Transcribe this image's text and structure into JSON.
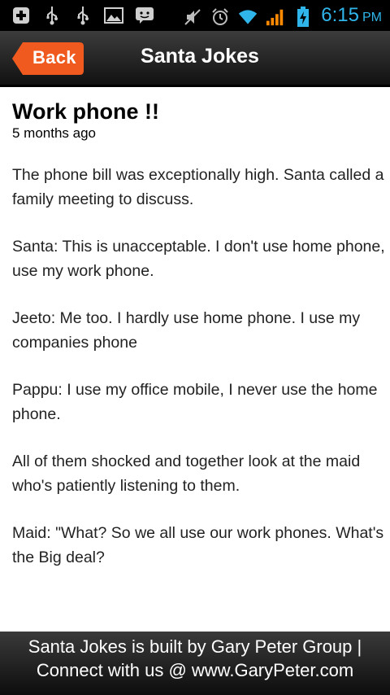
{
  "status_bar": {
    "left_icons": [
      "add-icon",
      "usb-icon",
      "usb-icon",
      "image-icon",
      "bbm-icon"
    ],
    "right_icons": [
      "mute-icon",
      "alarm-icon",
      "wifi-icon",
      "signal-icon",
      "battery-charging-icon"
    ],
    "time": "6:15",
    "ampm": "PM",
    "time_color": "#2fb5ea"
  },
  "header": {
    "back_label": "Back",
    "back_color": "#f05a1f",
    "title": "Santa Jokes"
  },
  "post": {
    "title": "Work phone !!",
    "time_ago": "5 months ago",
    "paragraphs": [
      "The phone bill was exceptionally high. Santa called a family meeting to discuss.",
      "Santa: This is unacceptable. I don't use home phone, use my work phone.",
      "Jeeto: Me too. I hardly use home phone. I use my companies phone",
      "Pappu: I use my office mobile, I never use the home phone.",
      "All of them shocked and together look at the maid who's patiently listening to them.",
      "Maid: \"What? So we all use our work phones. What's the Big deal?"
    ]
  },
  "footer": {
    "line1": "Santa Jokes is built by Gary Peter Group |",
    "line2": "Connect with us @ www.GaryPeter.com"
  }
}
